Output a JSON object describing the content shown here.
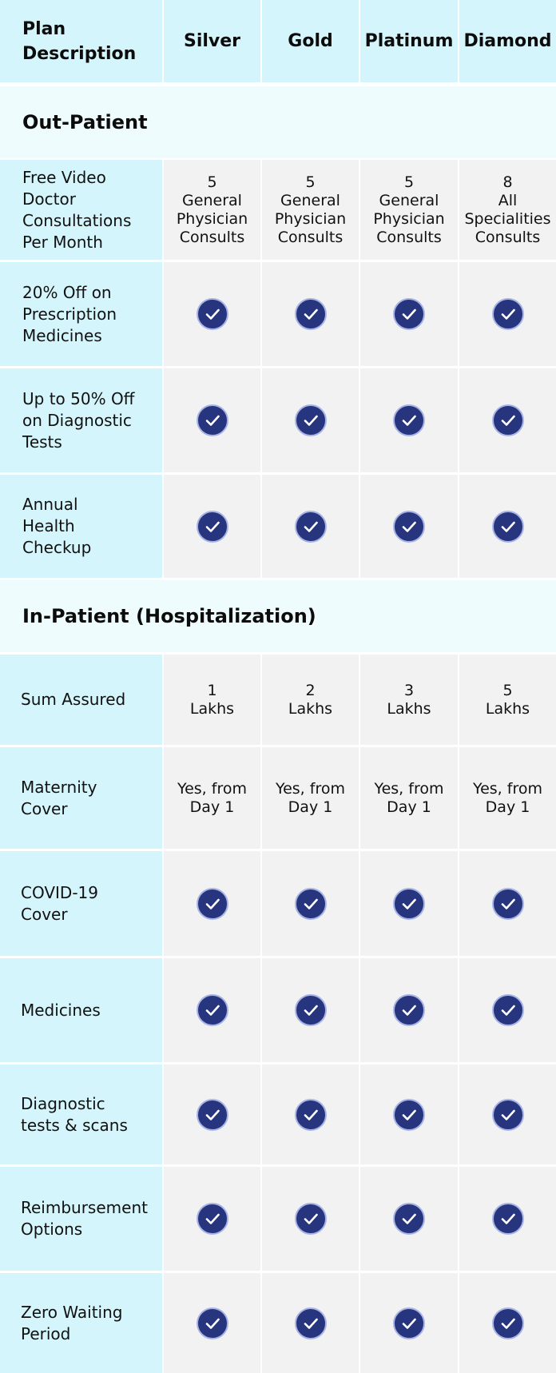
{
  "header": {
    "description": "Plan\nDescription",
    "plans": [
      "Silver",
      "Gold",
      "Platinum",
      "Diamond"
    ]
  },
  "sections": {
    "outpatient": "Out-Patient",
    "inpatient": "In-Patient (Hospitalization)"
  },
  "rows": [
    {
      "label": "Free Video\nDoctor\nConsultations\nPer Month",
      "values": [
        "5\nGeneral\nPhysician\nConsults",
        "5\nGeneral\nPhysician\nConsults",
        "5\nGeneral\nPhysician\nConsults",
        "8\nAll\nSpecialities\nConsults"
      ]
    },
    {
      "label": "20% Off on\nPrescription\nMedicines",
      "values": [
        "check",
        "check",
        "check",
        "check"
      ]
    },
    {
      "label": "Up to 50% Off\non Diagnostic\nTests",
      "values": [
        "check",
        "check",
        "check",
        "check"
      ]
    },
    {
      "label": "Annual\nHealth\nCheckup",
      "values": [
        "check",
        "check",
        "check",
        "check"
      ]
    },
    {
      "label": "Sum Assured",
      "values": [
        "1\nLakhs",
        "2\nLakhs",
        "3\nLakhs",
        "5\nLakhs"
      ]
    },
    {
      "label": "Maternity\nCover",
      "values": [
        "Yes, from\nDay 1",
        "Yes, from\nDay 1",
        "Yes, from\nDay 1",
        "Yes, from\nDay 1"
      ]
    },
    {
      "label": "COVID-19\nCover",
      "values": [
        "check",
        "check",
        "check",
        "check"
      ]
    },
    {
      "label": "Medicines",
      "values": [
        "check",
        "check",
        "check",
        "check"
      ]
    },
    {
      "label": "Diagnostic\ntests & scans",
      "values": [
        "check",
        "check",
        "check",
        "check"
      ]
    },
    {
      "label": "Reimbursement\nOptions",
      "values": [
        "check",
        "check",
        "check",
        "check"
      ]
    },
    {
      "label": "Zero Waiting\nPeriod",
      "values": [
        "check",
        "check",
        "check",
        "check"
      ]
    }
  ],
  "colors": {
    "header_bg": "#d4f5fb",
    "section_bg": "#eefcfd",
    "cell_bg": "#f2f2f2",
    "check_bg": "#26357e"
  },
  "icons": {
    "included": "check-circle-icon"
  }
}
